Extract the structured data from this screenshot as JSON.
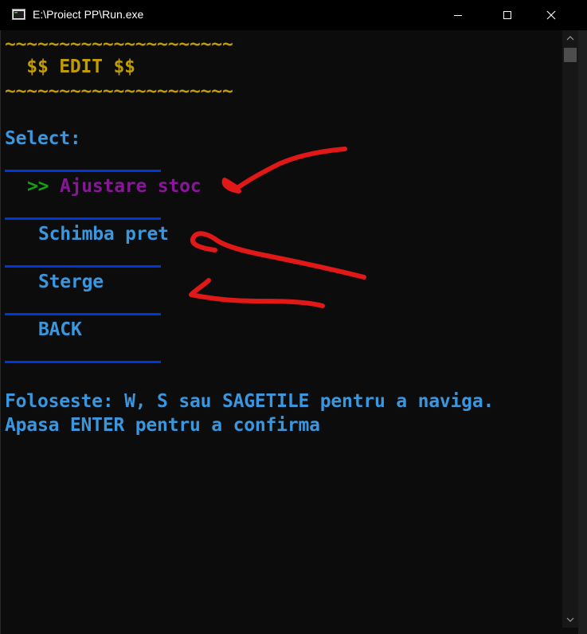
{
  "window": {
    "title": "E:\\Proiect PP\\Run.exe"
  },
  "console": {
    "border_top": "~~~~~~~~~~~~~~~~~~~~~",
    "heading": "  $$ EDIT $$",
    "border_bottom": "~~~~~~~~~~~~~~~~~~~~~",
    "select_label": "Select:",
    "cursor": ">>",
    "menu": [
      {
        "label": "Ajustare stoc",
        "selected": true
      },
      {
        "label": "Schimba pret",
        "selected": false
      },
      {
        "label": "Sterge",
        "selected": false
      },
      {
        "label": "BACK",
        "selected": false
      }
    ],
    "help_line_1": "Foloseste: W, S sau SAGETILE pentru a naviga.",
    "help_line_2": "Apasa ENTER pentru a confirma"
  },
  "colors": {
    "background": "#0c0c0c",
    "gold": "#c19c00",
    "text_blue": "#3a96dd",
    "cursor_green": "#13a10e",
    "selected_magenta": "#881798",
    "separator_blue": "#0037da",
    "annotation_red": "#e01818"
  }
}
